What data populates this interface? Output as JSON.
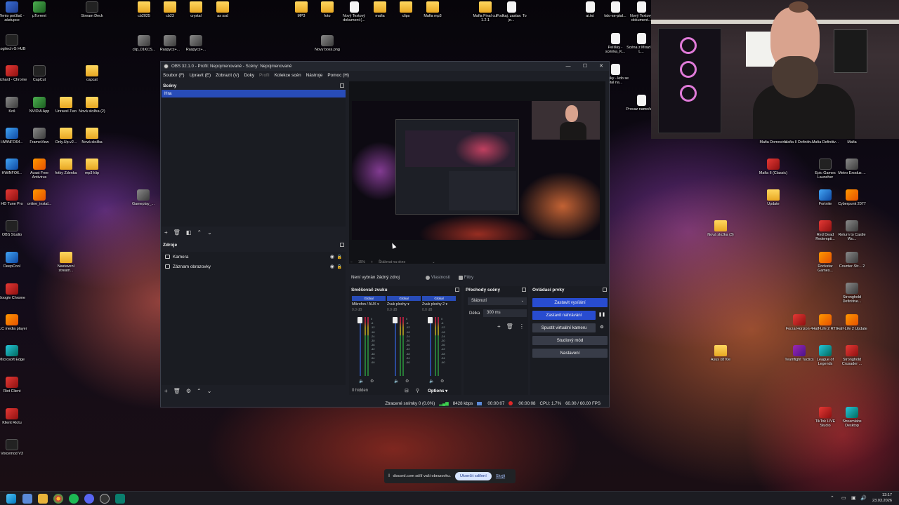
{
  "desktop": {
    "icons": [
      {
        "label": "Tento počítač - zástupce",
        "kind": "app"
      },
      {
        "label": "µTorrent",
        "kind": "green"
      },
      {
        "label": "Stream Deck",
        "kind": "dark"
      },
      {
        "label": "Logitech G HUB",
        "kind": "dark"
      },
      {
        "label": "Richard - Chrome",
        "kind": "red"
      },
      {
        "label": "CapCut",
        "kind": "dark"
      },
      {
        "label": "capcat",
        "kind": "folder"
      },
      {
        "label": "Koš",
        "kind": "gray"
      },
      {
        "label": "NVIDIA App",
        "kind": "green"
      },
      {
        "label": "Unravel.Two",
        "kind": "folder"
      },
      {
        "label": "Nová složka (2)",
        "kind": "folder"
      },
      {
        "label": "HWiNFO64...",
        "kind": "blue"
      },
      {
        "label": "FrameView",
        "kind": "gray"
      },
      {
        "label": "Only.Up.v2...",
        "kind": "folder"
      },
      {
        "label": "Nová složka",
        "kind": "folder"
      },
      {
        "label": "HWiNFO6...",
        "kind": "blue"
      },
      {
        "label": "Avast Free Antivirus",
        "kind": "orange"
      },
      {
        "label": "fotky Zdenka",
        "kind": "folder"
      },
      {
        "label": "mp3 klip",
        "kind": "folder"
      },
      {
        "label": "HD Tune Pro",
        "kind": "red"
      },
      {
        "label": "online_instal...",
        "kind": "orange"
      },
      {
        "label": "Gameplay_...",
        "kind": "gray"
      },
      {
        "label": "OBS Studio",
        "kind": "dark"
      },
      {
        "label": "DeepCool",
        "kind": "blue"
      },
      {
        "label": "Google Chrome",
        "kind": "red"
      },
      {
        "label": "VLC media player",
        "kind": "orange"
      },
      {
        "label": "Microsoft Edge",
        "kind": "teal"
      },
      {
        "label": "Riot Client",
        "kind": "red"
      },
      {
        "label": "Klient Riotu",
        "kind": "red"
      },
      {
        "label": "Voicemod V3",
        "kind": "dark"
      },
      {
        "label": "cb2025",
        "kind": "folder"
      },
      {
        "label": "cb23",
        "kind": "folder"
      },
      {
        "label": "crystal",
        "kind": "folder"
      },
      {
        "label": "as ssd",
        "kind": "folder"
      },
      {
        "label": "clip_01KCS...",
        "kind": "gray"
      },
      {
        "label": "Raspycz+...",
        "kind": "gray"
      },
      {
        "label": "Raspycz+...",
        "kind": "gray"
      },
      {
        "label": "MP3",
        "kind": "folder"
      },
      {
        "label": "foto",
        "kind": "folder"
      },
      {
        "label": "Nový Textový dokument (...",
        "kind": "doc"
      },
      {
        "label": "mafia",
        "kind": "folder"
      },
      {
        "label": "clips",
        "kind": "folder"
      },
      {
        "label": "Mafia mp3",
        "kind": "folder"
      },
      {
        "label": "Novy boss.png",
        "kind": "gray"
      },
      {
        "label": "Mafia Final cut 1.2.1",
        "kind": "folder"
      },
      {
        "label": "Podkaj. zastav. To je...",
        "kind": "doc"
      },
      {
        "label": "ai.txt",
        "kind": "doc"
      },
      {
        "label": "kdo-se-ptal...",
        "kind": "doc"
      },
      {
        "label": "Nový Textový dokument...",
        "kind": "doc"
      },
      {
        "label": "Pelíšky - scénka_K...",
        "kind": "doc"
      },
      {
        "label": "Scéna z Mrazíka, L...",
        "kind": "doc"
      },
      {
        "label": "Pelíšky - kdo se ptal na...",
        "kind": "doc"
      },
      {
        "label": "Provaz namočený",
        "kind": "doc"
      },
      {
        "label": "Mafia Domovina",
        "kind": "red"
      },
      {
        "label": "Mafia II Definitiv...",
        "kind": "red"
      },
      {
        "label": "Mafia Definitiv...",
        "kind": "gray"
      },
      {
        "label": "Mafia",
        "kind": "gray"
      },
      {
        "label": "Mafia II (Classic)",
        "kind": "red"
      },
      {
        "label": "Epic Games Launcher",
        "kind": "dark"
      },
      {
        "label": "Metro Exodus ...",
        "kind": "gray"
      },
      {
        "label": "Update",
        "kind": "folder"
      },
      {
        "label": "Fortnite",
        "kind": "blue"
      },
      {
        "label": "Cyberpunk 2077",
        "kind": "orange"
      },
      {
        "label": "Nová složka (3)",
        "kind": "folder"
      },
      {
        "label": "Red Dead Redempti...",
        "kind": "red"
      },
      {
        "label": "Return to Castle Wo...",
        "kind": "gray"
      },
      {
        "label": "Rockstar Games...",
        "kind": "orange"
      },
      {
        "label": "Counter-Str... 2",
        "kind": "gray"
      },
      {
        "label": "Stronghold Definitive...",
        "kind": "gray"
      },
      {
        "label": "Forza Horizon 4",
        "kind": "red"
      },
      {
        "label": "Half-Life 2 RTX",
        "kind": "orange"
      },
      {
        "label": "Half-Life 2 Update",
        "kind": "orange"
      },
      {
        "label": "Teamfight Tactics",
        "kind": "purple"
      },
      {
        "label": "League of Legends",
        "kind": "teal"
      },
      {
        "label": "Stronghold Crusader ...",
        "kind": "red"
      },
      {
        "label": "Asus x870e",
        "kind": "folder"
      },
      {
        "label": "TikTok LIVE Studio",
        "kind": "red"
      },
      {
        "label": "Streamlabs Desktop",
        "kind": "teal"
      },
      {
        "label": "Nastavení stream...",
        "kind": "folder"
      }
    ]
  },
  "obs": {
    "window_title": "OBS 32.1.0 - Profil: Nepojmenované - Scény: Nepojmenované",
    "menu": [
      "Soubor (F)",
      "Upravit (E)",
      "Zobrazit (V)",
      "Doky",
      "Profil",
      "Kolekce scén",
      "Nástroje",
      "Pomoc (H)"
    ],
    "scenes": {
      "title": "Scény",
      "items": [
        "Hra"
      ]
    },
    "sources": {
      "title": "Zdroje",
      "items": [
        "Kamera",
        "Záznam obrazovky"
      ]
    },
    "preview_toolbar": {
      "zoom": "15%",
      "mode": "Škálovat na okno"
    },
    "context": {
      "no_source": "Není vybrán žádný zdroj",
      "properties": "Vlastnosti",
      "filters": "Filtry"
    },
    "mixer": {
      "title": "Směšovač zvuku",
      "channels": [
        {
          "tag": "Global",
          "name": "Mikrofon / AUX",
          "db": "0.0 dB"
        },
        {
          "tag": "Global",
          "name": "Zvuk plochy",
          "db": "0.0 dB"
        },
        {
          "tag": "Global",
          "name": "Zvuk plochy 2",
          "db": "0.0 dB"
        }
      ],
      "scale": [
        "0",
        "-6",
        "-12",
        "-18",
        "-24",
        "-30",
        "-36",
        "-42",
        "-48",
        "-54",
        "-60"
      ],
      "hidden": "0 hidden",
      "options": "Options"
    },
    "transitions": {
      "title": "Přechody scény",
      "selected": "Slábnutí",
      "duration_label": "Délka",
      "duration": "300 ms"
    },
    "controls": {
      "title": "Ovládací prvky",
      "stop_stream": "Zastavit vysílání",
      "stop_record": "Zastavit nahrávání",
      "virtual_cam": "Spustit virtuální kameru",
      "studio_mode": "Studiový mód",
      "settings": "Nastavení"
    },
    "status": {
      "dropped": "Ztracené snímky 0 (0.0%)",
      "bitrate": "8428 kbps",
      "stream_time": "00:00:07",
      "rec_time": "00:00:08",
      "cpu": "CPU: 1.7%",
      "fps": "60.00 / 60.00 FPS"
    }
  },
  "share_bar": {
    "text": "discord.com sdílí vaši obrazovku.",
    "stop": "Ukončit sdílení",
    "hide": "Skrýt"
  },
  "taskbar": {
    "time": "13:17",
    "date": "23.03.2026"
  }
}
